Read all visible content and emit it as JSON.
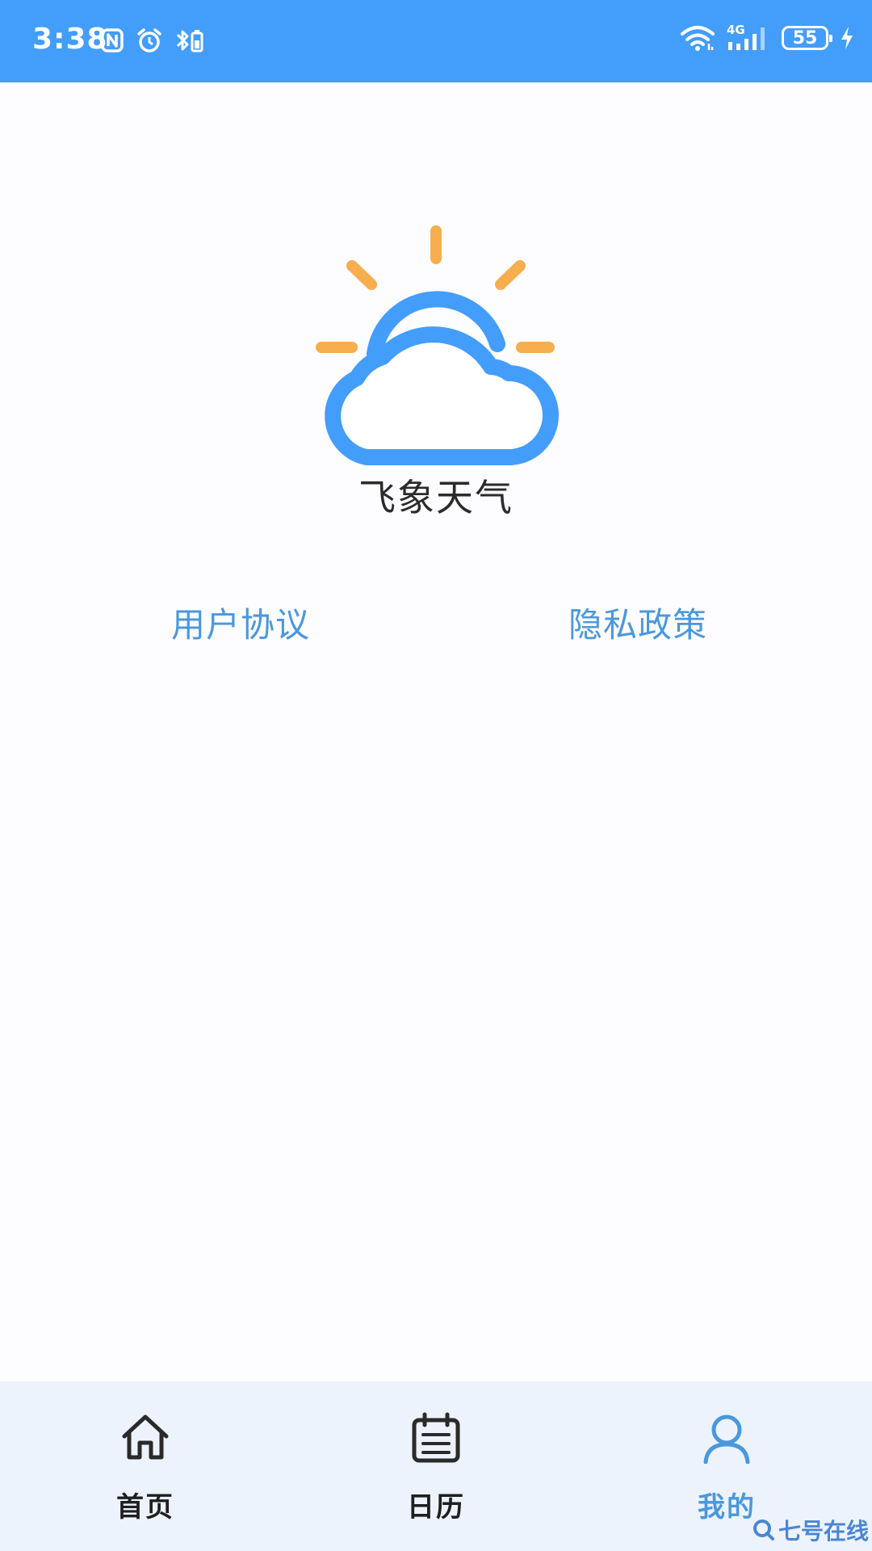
{
  "status_bar": {
    "time": "3:38",
    "network": "4G",
    "battery": "55"
  },
  "app": {
    "name": "飞象天气"
  },
  "links": {
    "user_agreement": "用户协议",
    "privacy_policy": "隐私政策"
  },
  "bottom_nav": {
    "items": [
      {
        "label": "首页",
        "icon": "home-icon",
        "active": false
      },
      {
        "label": "日历",
        "icon": "calendar-icon",
        "active": false
      },
      {
        "label": "我的",
        "icon": "user-icon",
        "active": true
      }
    ]
  },
  "watermark": {
    "text": "七号在线"
  },
  "colors": {
    "status_bar": "#439dfb",
    "accent_blue": "#4a98dd",
    "sun_orange": "#f7ae4f",
    "nav_background": "#edf3fd",
    "page_background": "#fdfcff"
  }
}
